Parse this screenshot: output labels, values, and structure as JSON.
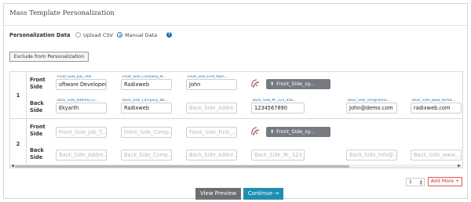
{
  "panel": {
    "title": "Mass Template Personalization"
  },
  "personalization": {
    "label": "Personalization Data",
    "options": [
      {
        "label": "Upload CSV",
        "selected": false
      },
      {
        "label": "Manual Data",
        "selected": true
      }
    ],
    "help_icon": "question-circle-icon"
  },
  "exclude_button": "Exclude from Personalization",
  "rows": [
    {
      "number": "1",
      "front": {
        "side_label": "Front\nSide",
        "fields": [
          {
            "caption": "Front_Side_Job_Title",
            "value": "oftware Developer",
            "placeholder": "Front_Side_Job_T..."
          },
          {
            "caption": "Front_Side_Company_N...",
            "value": "Radixweb",
            "placeholder": "Front_Side_Comp..."
          },
          {
            "caption": "Front_Side_First_Nam...",
            "value": "John",
            "placeholder": "Front_Side_First_..."
          }
        ],
        "upload_label": "Front_Side_sy..."
      },
      "back": {
        "side_label": "Back\nSide",
        "fields": [
          {
            "caption": "Back_Side_Address_Li...",
            "value": "Ekyarth",
            "placeholder": "Back_Side_Addre..."
          },
          {
            "caption": "Back_Side_Company_Na...",
            "value": "Radixweb",
            "placeholder": "Back_Side_Comp..."
          },
          {
            "caption": "",
            "value": "",
            "placeholder": "Back_Side_Addre..."
          },
          {
            "caption": "Back_Side_M:_123_456...",
            "value": "1234567890",
            "placeholder": "Back_Side_M:_123_456..."
          },
          {
            "caption": "Back_Side_info@doma...",
            "value": "John@demo.com",
            "placeholder": "Back_Side_info@..."
          },
          {
            "caption": "Back_Side_www_domai...",
            "value": "radixweb.com",
            "placeholder": "Back_Side_www_..."
          }
        ]
      }
    },
    {
      "number": "2",
      "front": {
        "side_label": "Front\nSide",
        "fields": [
          {
            "caption": "",
            "value": "",
            "placeholder": "Front_Side_Job_T..."
          },
          {
            "caption": "",
            "value": "",
            "placeholder": "Front_Side_Comp..."
          },
          {
            "caption": "",
            "value": "",
            "placeholder": "Front_Side_First_..."
          }
        ],
        "upload_label": "Front_Side_sy..."
      },
      "back": {
        "side_label": "Back\nSide",
        "fields": [
          {
            "caption": "",
            "value": "",
            "placeholder": "Back_Side_Addre..."
          },
          {
            "caption": "",
            "value": "",
            "placeholder": "Back_Side_Comp..."
          },
          {
            "caption": "",
            "value": "",
            "placeholder": "Back_Side_Addre..."
          },
          {
            "caption": "",
            "value": "",
            "placeholder": "Back_Side_M:_123_456..."
          },
          {
            "caption": "",
            "value": "",
            "placeholder": "Back_Side_info@..."
          },
          {
            "caption": "",
            "value": "",
            "placeholder": "Back_Side_www_..."
          }
        ]
      }
    }
  ],
  "pager": {
    "value": "1"
  },
  "add_more": "Add More +",
  "buttons": {
    "view_preview": "View Preview",
    "continue": "Continue →"
  },
  "colors": {
    "accent": "#1a73b8",
    "continue": "#1e8fb0",
    "add_more": "#c9302c",
    "upload": "#777b80"
  }
}
